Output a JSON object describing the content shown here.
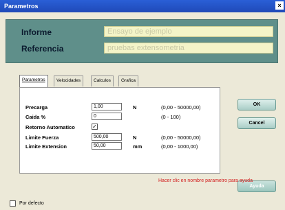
{
  "window": {
    "title": "Parametros",
    "close_symbol": "×"
  },
  "header": {
    "informe_label": "Informe",
    "informe_value": "Ensayo de ejemplo",
    "referencia_label": "Referencia",
    "referencia_value": "pruebas extensometria"
  },
  "tabs": [
    {
      "label": "Parametros",
      "active": true
    },
    {
      "label": "Velocidades",
      "active": false
    },
    {
      "label": "Calculos",
      "active": false
    },
    {
      "label": "Grafica",
      "active": false
    }
  ],
  "params": [
    {
      "label": "Precarga",
      "value": "1,00",
      "unit": "N",
      "range": "(0,00 - 50000,00)"
    },
    {
      "label": "Caida %",
      "value": "0",
      "unit": "",
      "range": "(0 - 100)"
    },
    {
      "label": "Retorno Automatico",
      "checked": true,
      "check_symbol": "✓"
    },
    {
      "label": "Limite Fuerza",
      "value": "500,00",
      "unit": "N",
      "range": "(0,00 - 50000,00)"
    },
    {
      "label": "Limite Extension",
      "value": "50,00",
      "unit": "mm",
      "range": "(0,00 - 1000,00)"
    }
  ],
  "buttons": {
    "ok": "OK",
    "cancel": "Cancel",
    "help": "Ayuda"
  },
  "help_hint": "Hacer clic en nombre parametro para ayuda",
  "footer": {
    "default_label": "Por defecto",
    "default_checked": false
  }
}
